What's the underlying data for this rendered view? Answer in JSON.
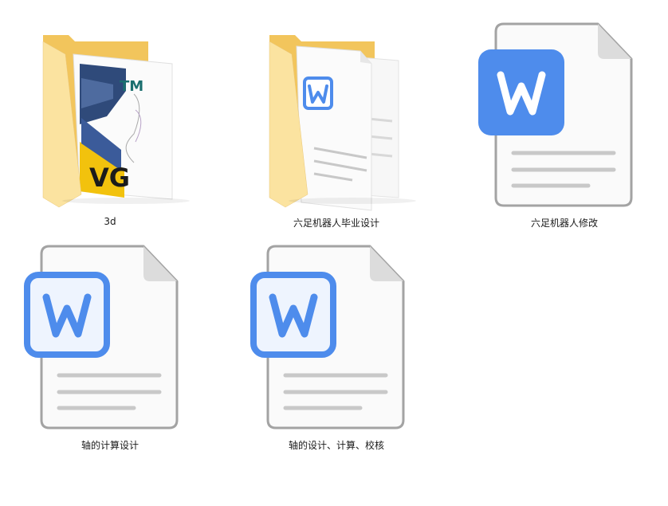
{
  "files": [
    {
      "name": "3d",
      "type": "folder-image"
    },
    {
      "name": "六足机器人毕业设计",
      "type": "folder-doc"
    },
    {
      "name": "六足机器人修改",
      "type": "wps-doc"
    },
    {
      "name": "轴的计算设计",
      "type": "wps-doc"
    },
    {
      "name": "轴的设计、计算、校核",
      "type": "wps-doc"
    }
  ],
  "colors": {
    "folder_back": "#f2c55c",
    "folder_front": "#fbe3a0",
    "wps_blue": "#4e8cec",
    "doc_line": "#c8c8c8"
  },
  "icons": {
    "folder": "folder-icon",
    "wps": "wps-writer-document-icon"
  }
}
